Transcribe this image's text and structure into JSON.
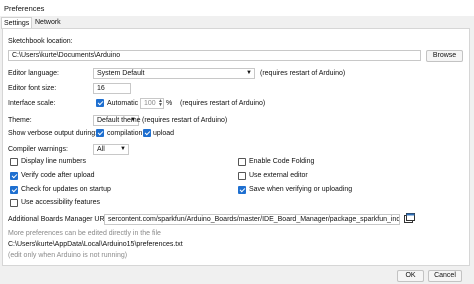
{
  "window": {
    "title": "Preferences"
  },
  "tabs": [
    {
      "label": "Settings"
    },
    {
      "label": "Network"
    }
  ],
  "sketchbook": {
    "label": "Sketchbook location:",
    "value": "C:\\Users\\kurte\\Documents\\Arduino",
    "browse_label": "Browse"
  },
  "language": {
    "label": "Editor language:",
    "value": "System Default",
    "note": "(requires restart of Arduino)"
  },
  "font_size": {
    "label": "Editor font size:",
    "value": "16"
  },
  "scale": {
    "label": "Interface scale:",
    "automatic_label": "Automatic",
    "value": "100",
    "unit": "%",
    "note": "(requires restart of Arduino)"
  },
  "theme": {
    "label": "Theme:",
    "value": "Default theme",
    "note": "(requires restart of Arduino)"
  },
  "verbose": {
    "label": "Show verbose output during:",
    "compilation_label": "compilation",
    "upload_label": "upload"
  },
  "warnings": {
    "label": "Compiler warnings:",
    "value": "All"
  },
  "options": {
    "display_line_numbers": "Display line numbers",
    "verify_code": "Verify code after upload",
    "check_updates": "Check for updates on startup",
    "accessibility": "Use accessibility features",
    "code_folding": "Enable Code Folding",
    "external_editor": "Use external editor",
    "save_verify": "Save when verifying or uploading"
  },
  "boards": {
    "label": "Additional Boards Manager URLs:",
    "value": "sercontent.com/sparkfun/Arduino_Boards/master/IDE_Board_Manager/package_sparkfun_index.json"
  },
  "info": {
    "more_prefs": "More preferences can be edited directly in the file",
    "path": "C:\\Users\\kurte\\AppData\\Local\\Arduino15\\preferences.txt",
    "edit_note": "(edit only when Arduino is not running)"
  },
  "buttons": {
    "ok": "OK",
    "cancel": "Cancel"
  }
}
